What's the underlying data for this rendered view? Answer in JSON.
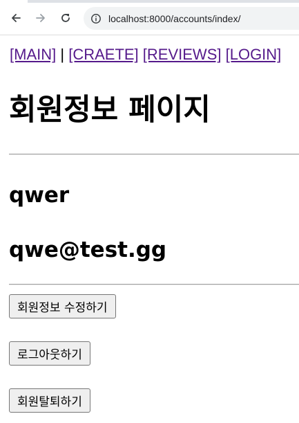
{
  "browser": {
    "url": "localhost:8000/accounts/index/",
    "back_icon": "arrow-left-icon",
    "forward_icon": "arrow-right-icon",
    "reload_icon": "reload-icon",
    "info_icon": "info-circle-icon"
  },
  "nav": {
    "main": "[MAIN]",
    "separator": "|",
    "create": "[CRAETE]",
    "reviews": "[REVIEWS]",
    "login": "[LOGIN]",
    "link_color": "#551a8b"
  },
  "page": {
    "title": "회원정보 페이지"
  },
  "user": {
    "username": "qwer",
    "email": "qwe@test.gg"
  },
  "actions": {
    "edit": "회원정보 수정하기",
    "logout": "로그아웃하기",
    "delete": "회원탈퇴하기"
  }
}
